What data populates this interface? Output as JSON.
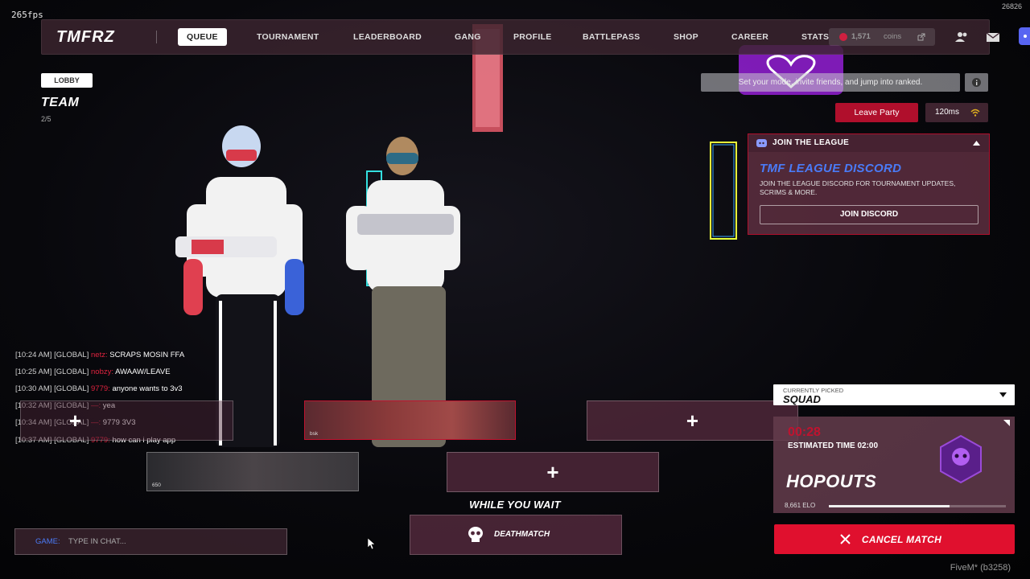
{
  "hud": {
    "fps": "265fps",
    "corner_number": "26826",
    "client_build": "FiveM* (b3258)"
  },
  "nav": {
    "logo": "TMFRZ",
    "items": [
      {
        "label": "QUEUE",
        "active": true
      },
      {
        "label": "TOURNAMENT",
        "active": false
      },
      {
        "label": "LEADERBOARD",
        "active": false
      },
      {
        "label": "GANG",
        "active": false
      },
      {
        "label": "PROFILE",
        "active": false
      },
      {
        "label": "BATTLEPASS",
        "active": false
      },
      {
        "label": "SHOP",
        "active": false
      },
      {
        "label": "CAREER",
        "active": false
      },
      {
        "label": "STATS",
        "active": false
      }
    ],
    "coins_value": "1,571",
    "coins_label": "coins",
    "icons": [
      "friends-icon",
      "mail-icon",
      "discord-icon"
    ]
  },
  "lobby": {
    "tag": "LOBBY",
    "title": "TEAM",
    "count": "2/5"
  },
  "info_bar": {
    "text": "Set your mode, invite friends, and jump into ranked."
  },
  "party": {
    "leave_label": "Leave Party",
    "ping": "120ms"
  },
  "league": {
    "header": "JOIN THE LEAGUE",
    "title": "TMF LEAGUE DISCORD",
    "description": "JOIN THE LEAGUE DISCORD FOR TOURNAMENT UPDATES, SCRIMS & MORE.",
    "button": "JOIN DISCORD"
  },
  "chat": {
    "messages": [
      {
        "time": "[10:24 AM]",
        "channel": "[GLOBAL]",
        "name": "netz:",
        "text": "SCRAPS MOSIN FFA"
      },
      {
        "time": "[10:25 AM]",
        "channel": "[GLOBAL]",
        "name": "nobzy:",
        "text": "AWAAW/LEAVE"
      },
      {
        "time": "[10:30 AM]",
        "channel": "[GLOBAL]",
        "name": "9779:",
        "text": "anyone wants to 3v3"
      },
      {
        "time": "[10:32 AM]",
        "channel": "[GLOBAL]",
        "name": "—:",
        "text": "yea"
      },
      {
        "time": "[10:34 AM]",
        "channel": "[GLOBAL]",
        "name": "—:",
        "text": "9779 3V3"
      },
      {
        "time": "[10:37 AM]",
        "channel": "[GLOBAL]",
        "name": "9779:",
        "text": "how can i play app"
      }
    ],
    "input_prefix": "GAME:",
    "input_placeholder": "TYPE IN CHAT..."
  },
  "slots": {
    "plus": "+",
    "player_card_1": {
      "name": "bsk"
    },
    "player_card_2": {
      "name": "650"
    }
  },
  "wait": {
    "title": "WHILE YOU WAIT",
    "deathmatch": "DEATHMATCH"
  },
  "queue": {
    "mode_caption": "CURRENTLY PICKED",
    "mode_value": "SQUAD",
    "timer": "00:28",
    "estimated": "ESTIMATED TIME 02:00",
    "map_name": "HOPOUTS",
    "elo": "8,661 ELO",
    "elo_progress": 0.68,
    "cancel_label": "CANCEL MATCH"
  },
  "colors": {
    "accent_red": "#e0102e",
    "league_blue": "#4a7bf7",
    "panel": "#3c2430"
  }
}
